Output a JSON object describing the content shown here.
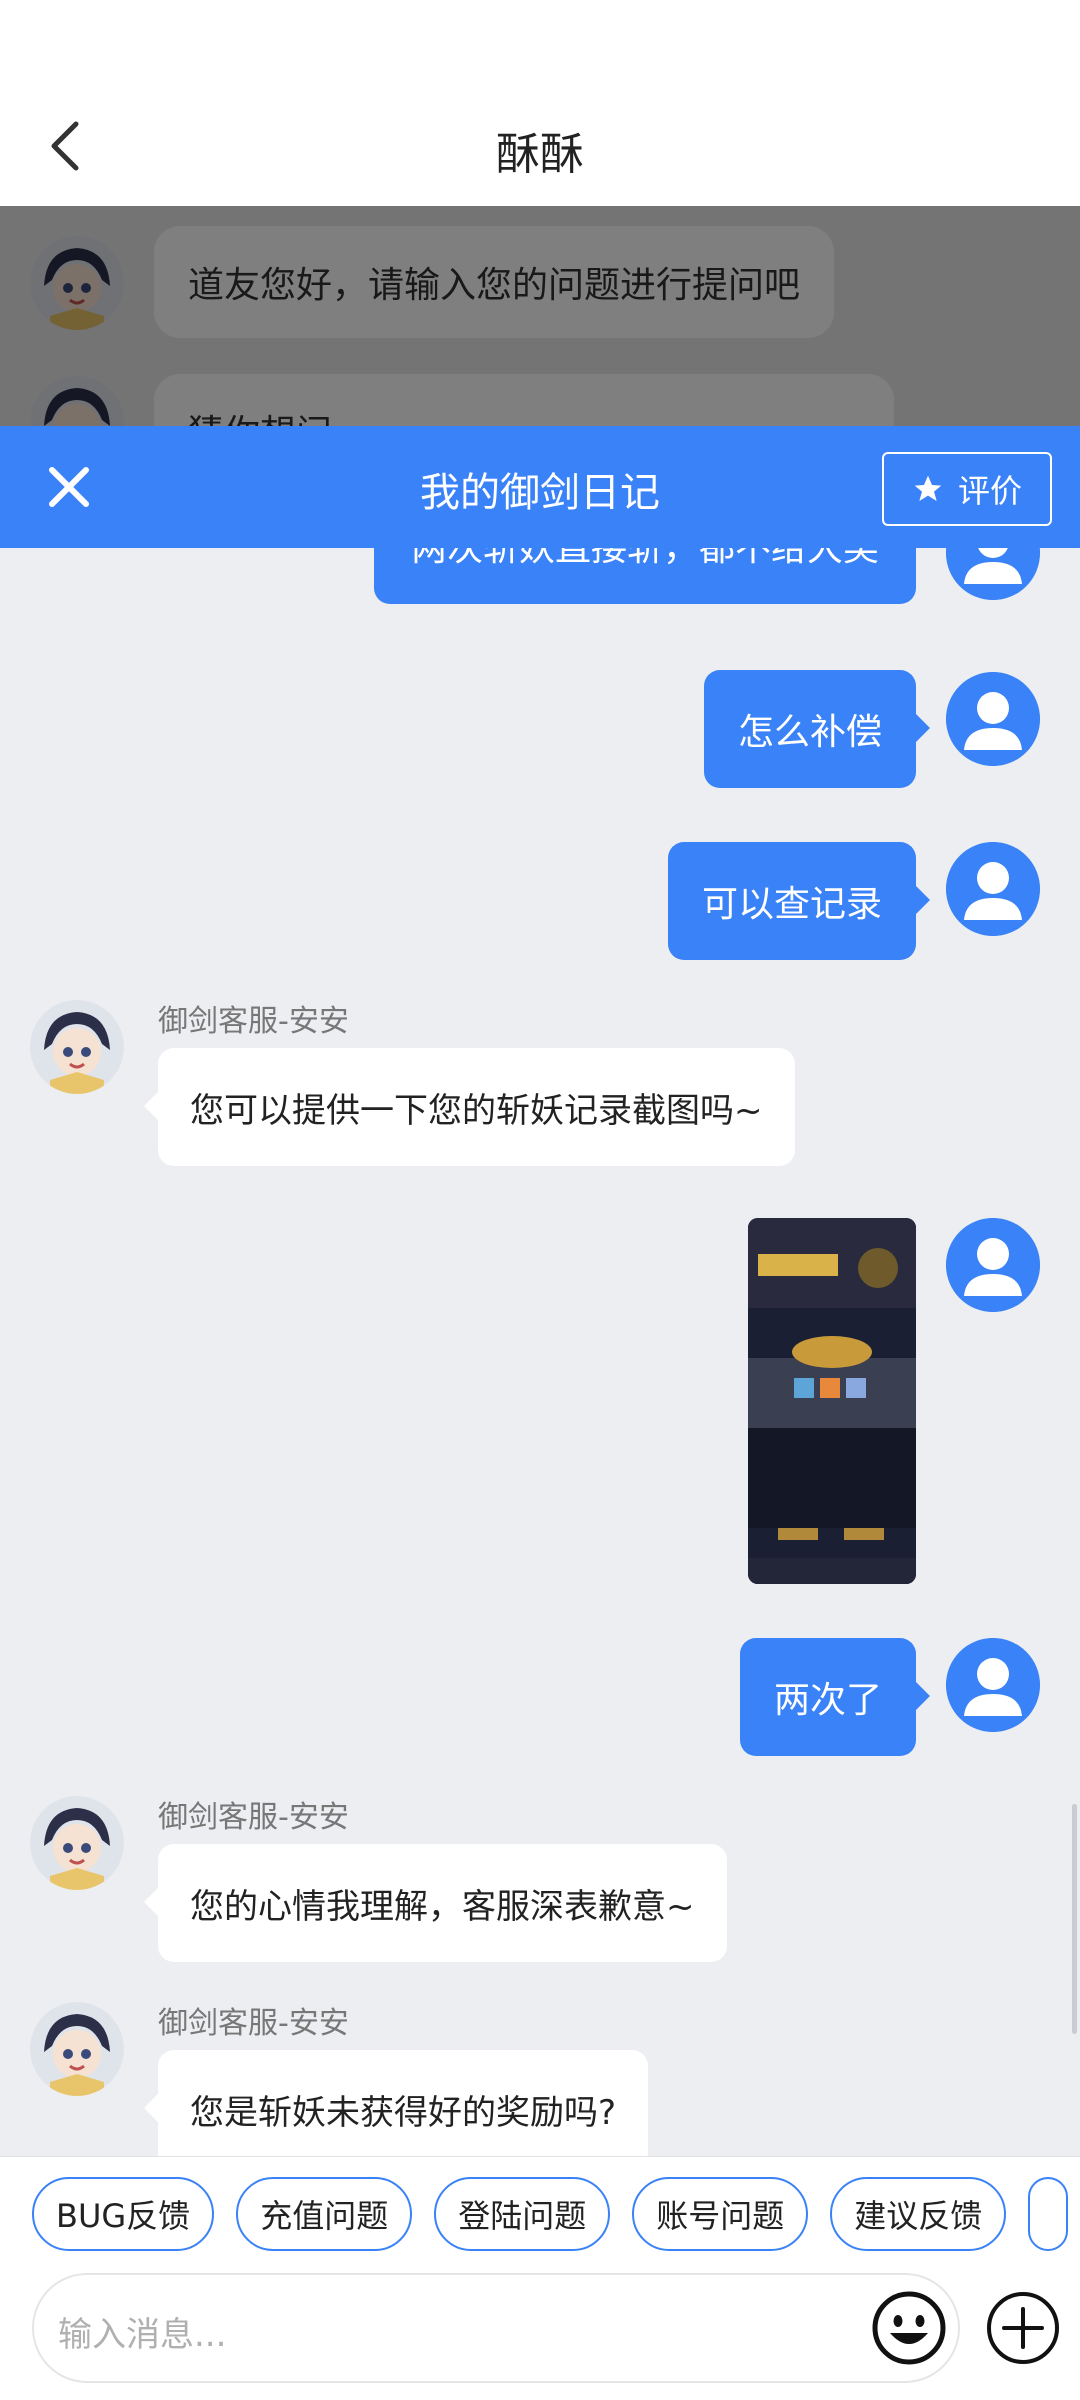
{
  "header": {
    "title": "酥酥"
  },
  "background_chat": {
    "greeting": "道友您好，请输入您的问题进行提问吧",
    "partial": "猜你想问"
  },
  "panel": {
    "title": "我的御剑日记",
    "rate_label": "评价"
  },
  "messages": {
    "m1": "两次斩妖直接斩，都不给大奖",
    "m2": "怎么补偿",
    "m3": "可以查记录",
    "a1_name": "御剑客服-安安",
    "a1_text": "您可以提供一下您的斩妖记录截图吗~",
    "m4": "两次了",
    "a2_name": "御剑客服-安安",
    "a2_text": "您的心情我理解，客服深表歉意~",
    "a3_name": "御剑客服-安安",
    "a3_text": "您是斩妖未获得好的奖励吗?"
  },
  "quick_replies": [
    "BUG反馈",
    "充值问题",
    "登陆问题",
    "账号问题",
    "建议反馈"
  ],
  "input": {
    "placeholder": "输入消息..."
  },
  "colors": {
    "accent": "#3a82f7",
    "chat_bg": "#eceef1"
  }
}
